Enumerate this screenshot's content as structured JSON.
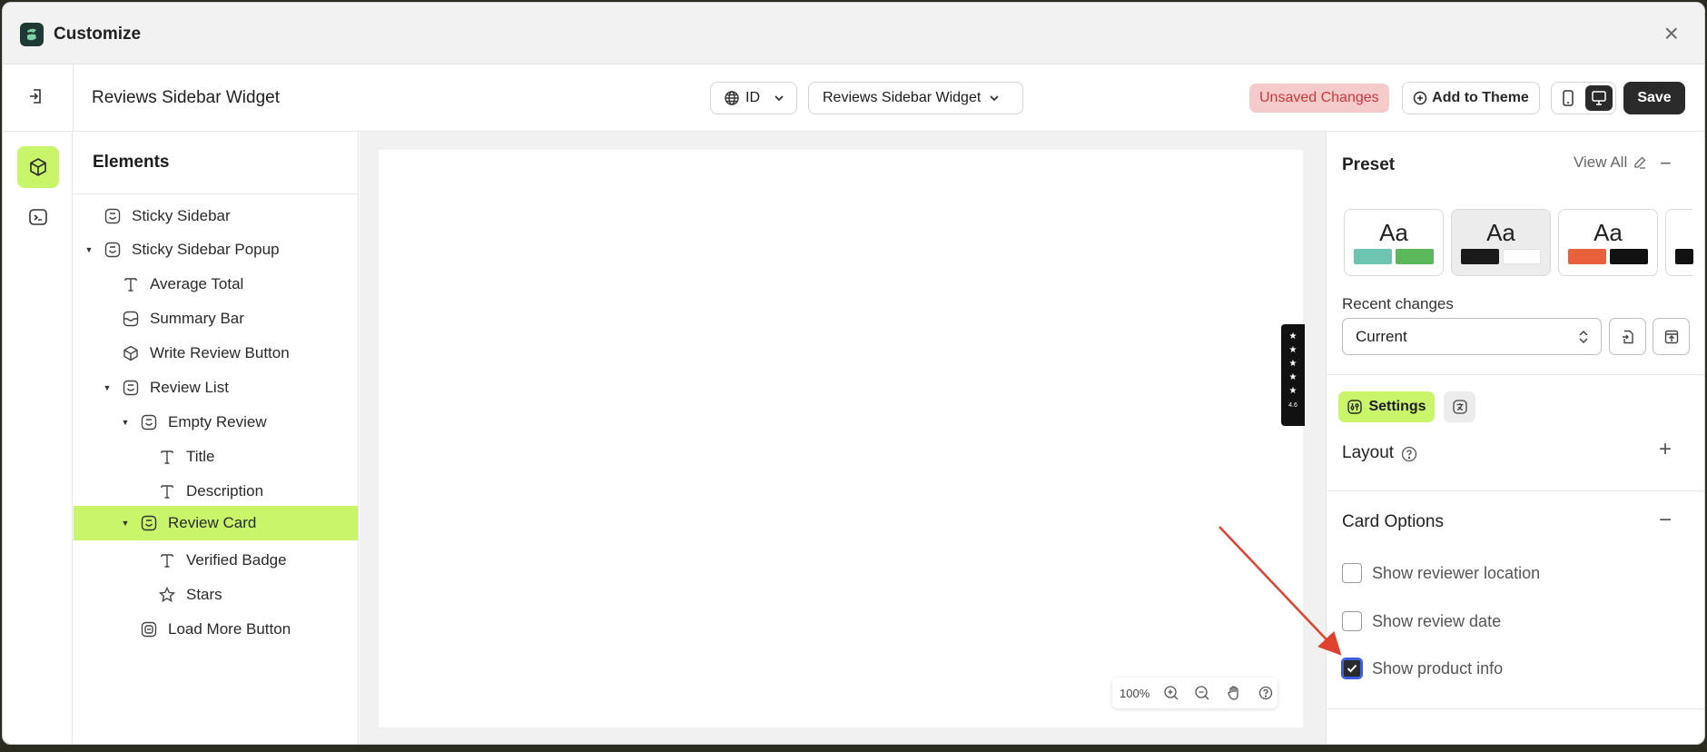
{
  "app": {
    "title": "Customize"
  },
  "toolbar": {
    "page_name": "Reviews Sidebar Widget",
    "language": "ID",
    "page_select": "Reviews Sidebar Widget",
    "unsaved_label": "Unsaved Changes",
    "add_theme_label": "Add to Theme",
    "save_label": "Save"
  },
  "elements": {
    "header": "Elements",
    "items": [
      {
        "label": "Sticky Sidebar",
        "icon": "section-icon"
      },
      {
        "label": "Sticky Sidebar Popup",
        "icon": "section-icon"
      },
      {
        "label": "Average Total",
        "icon": "text-icon"
      },
      {
        "label": "Summary Bar",
        "icon": "inbox-icon"
      },
      {
        "label": "Write Review Button",
        "icon": "cube-icon"
      },
      {
        "label": "Review List",
        "icon": "section-icon"
      },
      {
        "label": "Empty Review",
        "icon": "section-icon"
      },
      {
        "label": "Title",
        "icon": "text-icon"
      },
      {
        "label": "Description",
        "icon": "text-icon"
      },
      {
        "label": "Review Card",
        "icon": "section-icon"
      },
      {
        "label": "Verified Badge",
        "icon": "text-icon"
      },
      {
        "label": "Stars",
        "icon": "star-icon"
      },
      {
        "label": "Load More Button",
        "icon": "button-icon"
      }
    ],
    "selected": "Review Card"
  },
  "canvas": {
    "zoom": "100%",
    "widget_rating": "4.6"
  },
  "panel": {
    "preset_title": "Preset",
    "view_all": "View All",
    "preset_sample": "Aa",
    "recent_changes_label": "Recent changes",
    "recent_changes_value": "Current",
    "settings_tab": "Settings",
    "layout_title": "Layout",
    "card_options_title": "Card Options",
    "options": [
      {
        "label": "Show reviewer location",
        "checked": false
      },
      {
        "label": "Show review date",
        "checked": false
      },
      {
        "label": "Show product info",
        "checked": true
      }
    ]
  },
  "colors": {
    "accent": "#c8f56a",
    "dark": "#2a2a2a",
    "unsaved_bg": "#f5caca",
    "unsaved_text": "#c8393b",
    "annotation_arrow": "#e0412e",
    "preset_1": [
      "#6cc5b0",
      "#5bb85a"
    ],
    "preset_2": [
      "#1a1a1a",
      "#ffffff"
    ],
    "preset_3": [
      "#e8613c",
      "#111111"
    ]
  }
}
